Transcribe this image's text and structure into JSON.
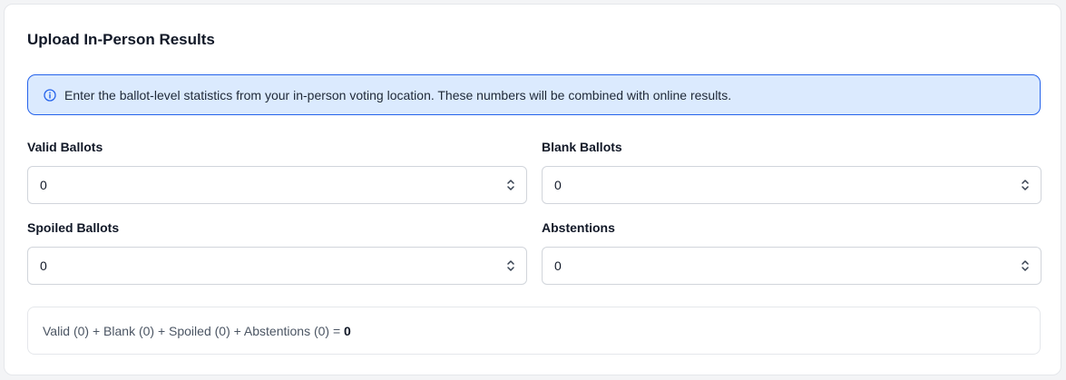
{
  "title": "Upload In-Person Results",
  "alert": {
    "icon": "info-circle-icon",
    "text": "Enter the ballot-level statistics from your in-person voting location. These numbers will be combined with online results.",
    "color": "#2563eb",
    "background": "#dbeafe"
  },
  "fields": {
    "valid": {
      "label": "Valid Ballots",
      "value": "0"
    },
    "blank": {
      "label": "Blank Ballots",
      "value": "0"
    },
    "spoiled": {
      "label": "Spoiled Ballots",
      "value": "0"
    },
    "abstentions": {
      "label": "Abstentions",
      "value": "0"
    }
  },
  "summary": {
    "formula": "Valid (0) + Blank (0) + Spoiled (0) + Abstentions (0) = ",
    "total": "0"
  }
}
